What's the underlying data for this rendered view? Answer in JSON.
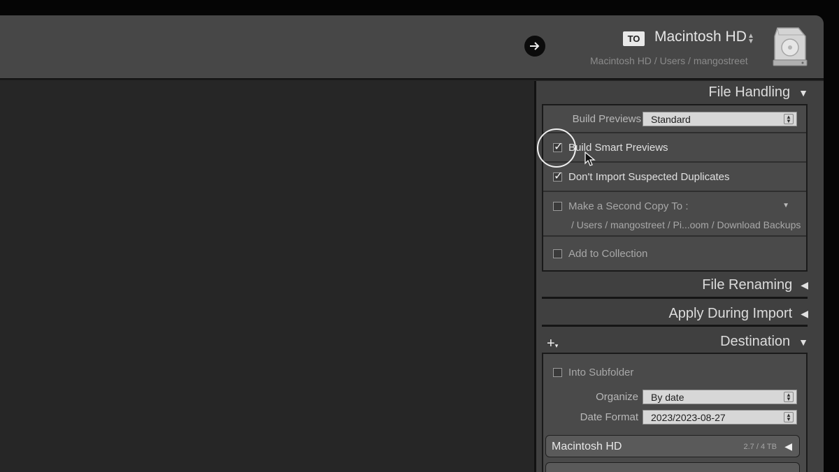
{
  "topbar": {
    "to_badge": "TO",
    "destination_volume": "Macintosh HD",
    "destination_path": "Macintosh HD / Users / mangostreet",
    "arrow_icon": "arrow-right-icon",
    "drive_icon": "hard-drive-icon"
  },
  "file_handling": {
    "title": "File Handling",
    "build_previews_label": "Build Previews",
    "build_previews_value": "Standard",
    "build_smart_previews": {
      "label": "Build Smart Previews",
      "checked": true
    },
    "dont_import_duplicates": {
      "label": "Don't Import Suspected Duplicates",
      "checked": true
    },
    "second_copy": {
      "label": "Make a Second Copy To :",
      "checked": false,
      "path": "/ Users / mangostreet / Pi...oom / Download Backups"
    },
    "add_to_collection": {
      "label": "Add to Collection",
      "checked": false
    }
  },
  "file_renaming": {
    "title": "File Renaming"
  },
  "apply_during_import": {
    "title": "Apply During Import"
  },
  "destination": {
    "title": "Destination",
    "into_subfolder": {
      "label": "Into Subfolder",
      "checked": false
    },
    "organize_label": "Organize",
    "organize_value": "By date",
    "date_format_label": "Date Format",
    "date_format_value": "2023/2023-08-27",
    "volumes": [
      {
        "name": "Macintosh HD",
        "size": "2.7 / 4 TB"
      }
    ]
  }
}
